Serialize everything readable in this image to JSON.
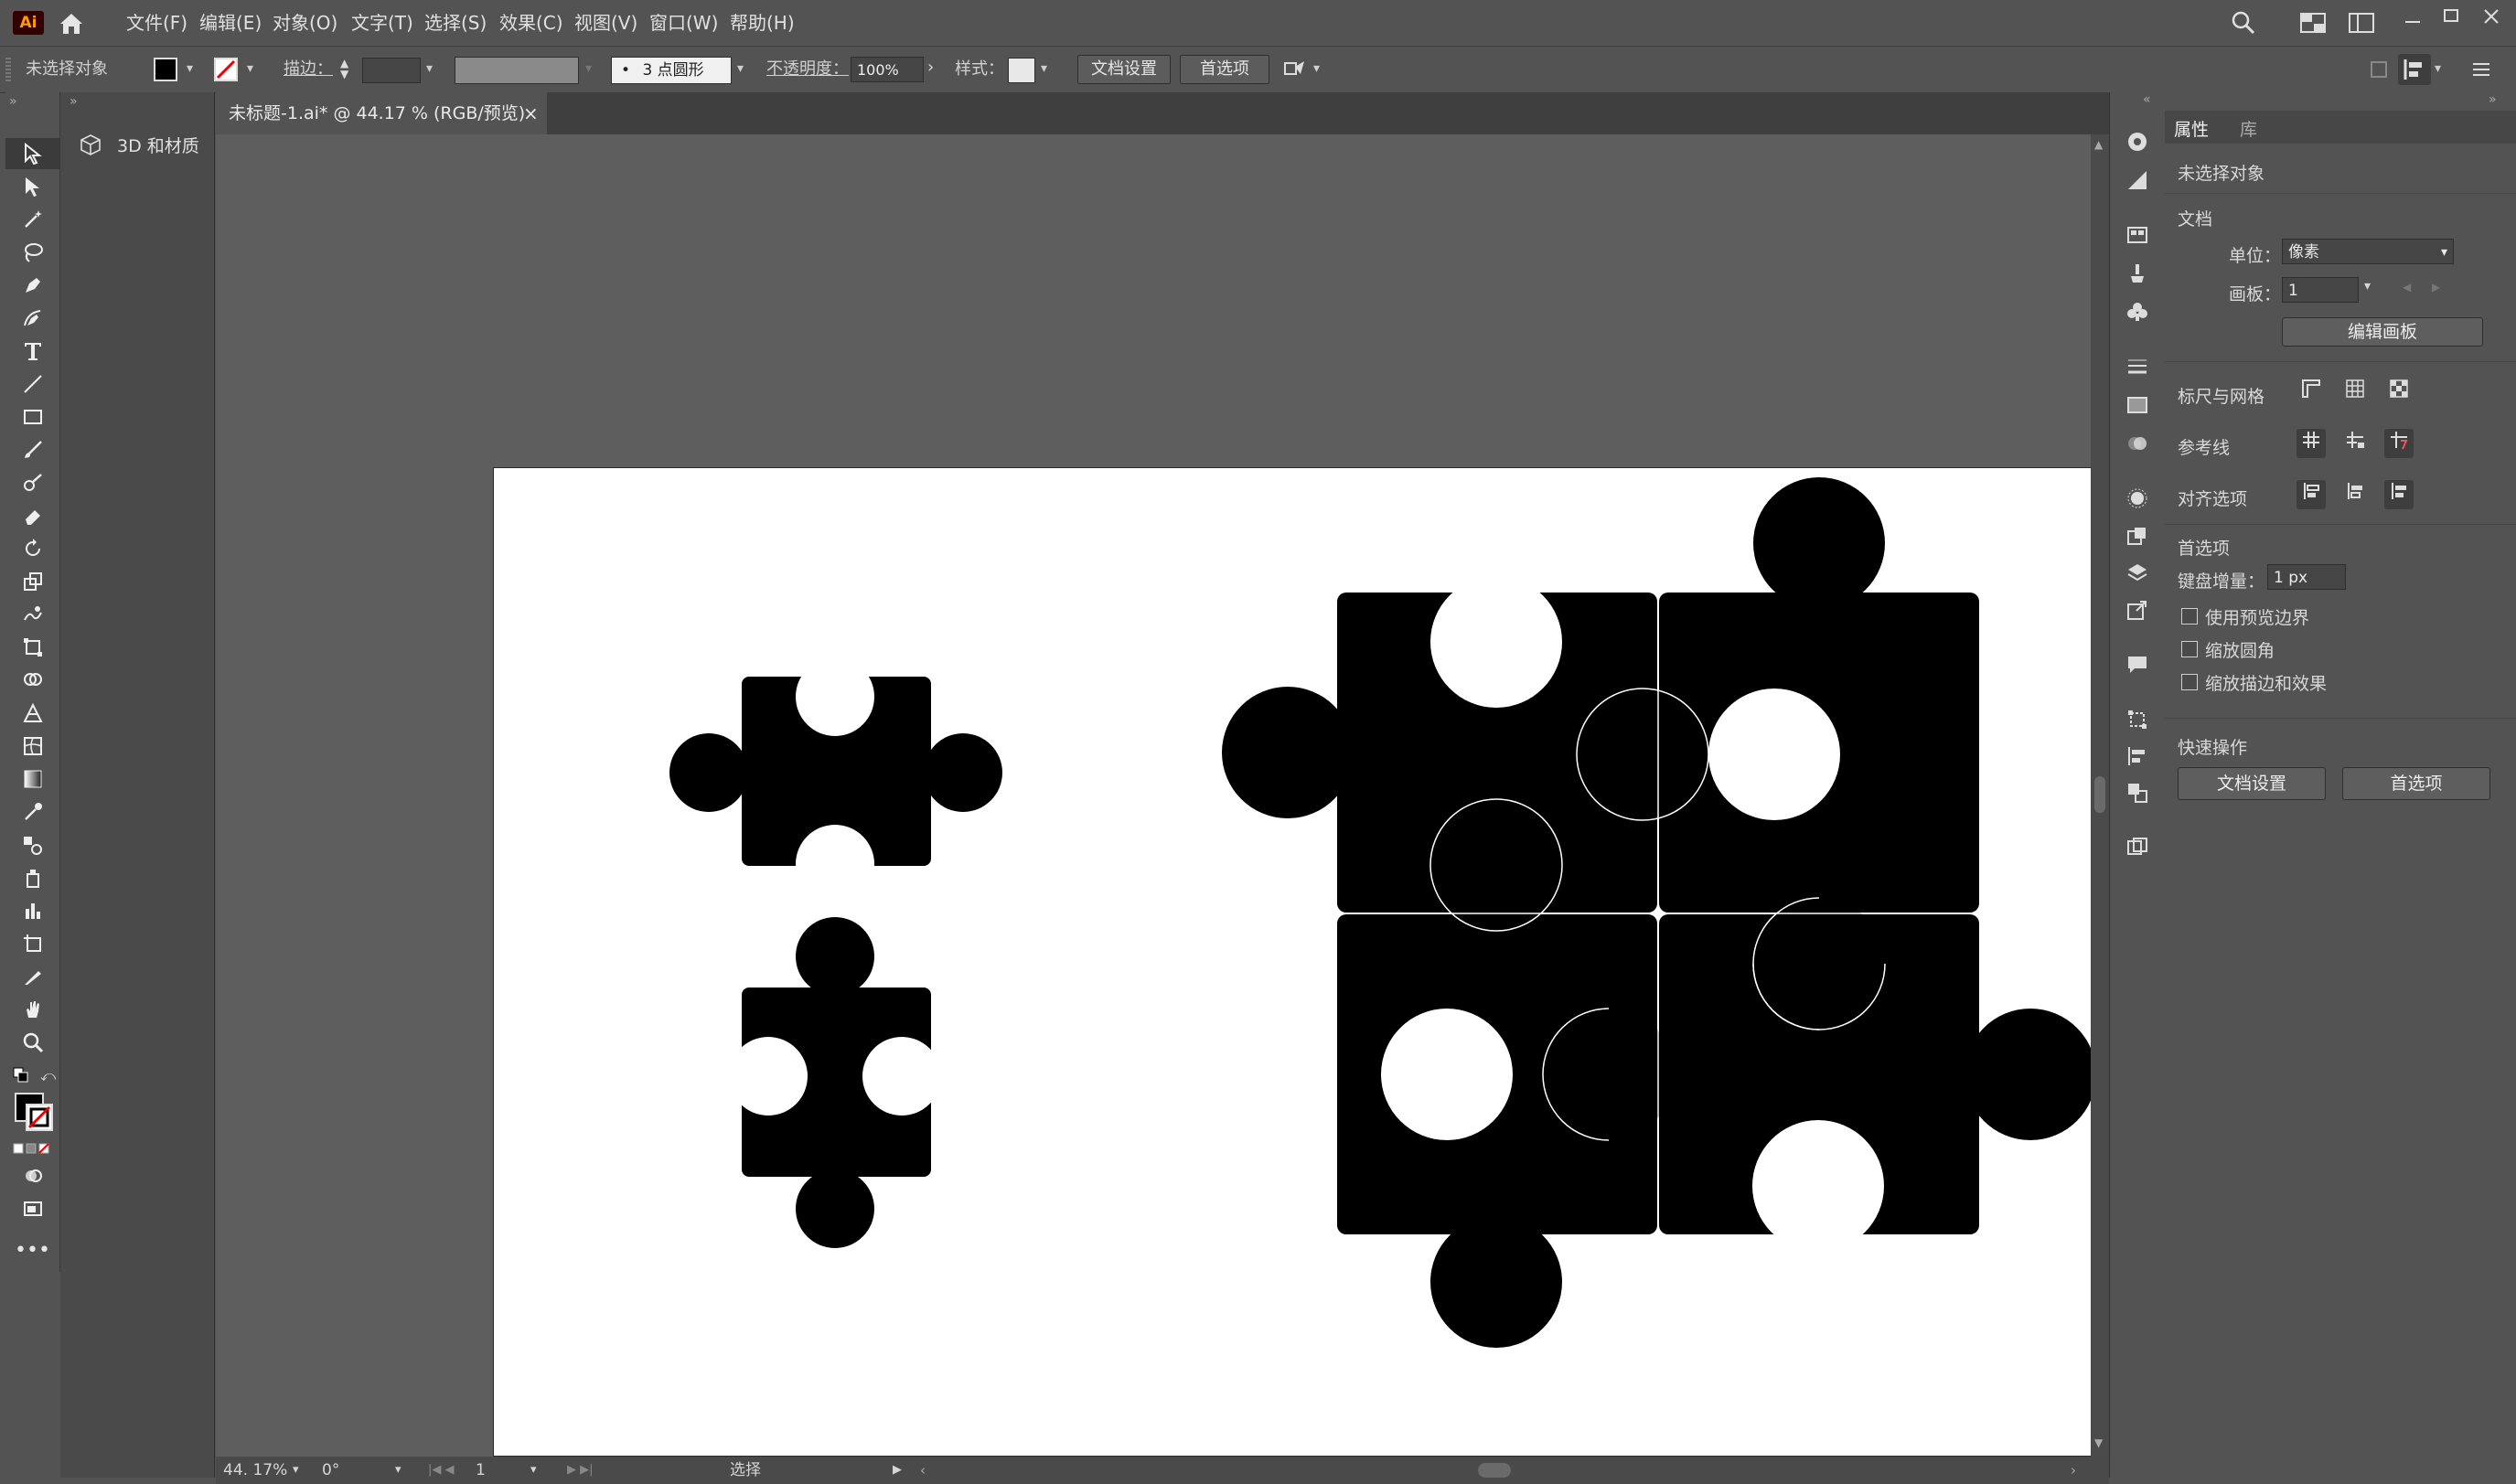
{
  "app": {
    "logo": "Ai",
    "home_icon": "home-icon"
  },
  "menu": [
    "文件(F)",
    "编辑(E)",
    "对象(O)",
    "文字(T)",
    "选择(S)",
    "效果(C)",
    "视图(V)",
    "窗口(W)",
    "帮助(H)"
  ],
  "control": {
    "selection": "未选择对象",
    "stroke_label": "描边：",
    "brush": "3 点圆形",
    "opacity_label": "不透明度：",
    "opacity": "100%",
    "style_label": "样式：",
    "doc_setup": "文档设置",
    "prefs": "首选项"
  },
  "panel_3d": {
    "label": "3D 和材质"
  },
  "doc": {
    "tab": "未标题-1.ai* @ 44.17 % (RGB/预览)",
    "close": "×"
  },
  "status": {
    "zoom": "44. 17%",
    "rotation": "0°",
    "artboard": "1",
    "tool": "选择"
  },
  "properties": {
    "tabs": [
      "属性",
      "库"
    ],
    "selection": "未选择对象",
    "doc_section": "文档",
    "unit_label": "单位：",
    "unit_value": "像素",
    "artboard_label": "画板：",
    "artboard_value": "1",
    "edit_artboard": "编辑画板",
    "rulers_grids": "标尺与网格",
    "guides": "参考线",
    "align_options": "对齐选项",
    "prefs_section": "首选项",
    "keyboard_inc_label": "键盘增量：",
    "keyboard_inc_value": "1 px",
    "chk_preview_bounds": "使用预览边界",
    "chk_scale_corners": "缩放圆角",
    "chk_scale_strokes": "缩放描边和效果",
    "quick_actions": "快速操作",
    "qa_doc_setup": "文档设置",
    "qa_prefs": "首选项"
  },
  "colors": {
    "fill": "#000000",
    "artboard": "#ffffff",
    "workspace": "#5e5e5e",
    "ui": "#535353"
  }
}
